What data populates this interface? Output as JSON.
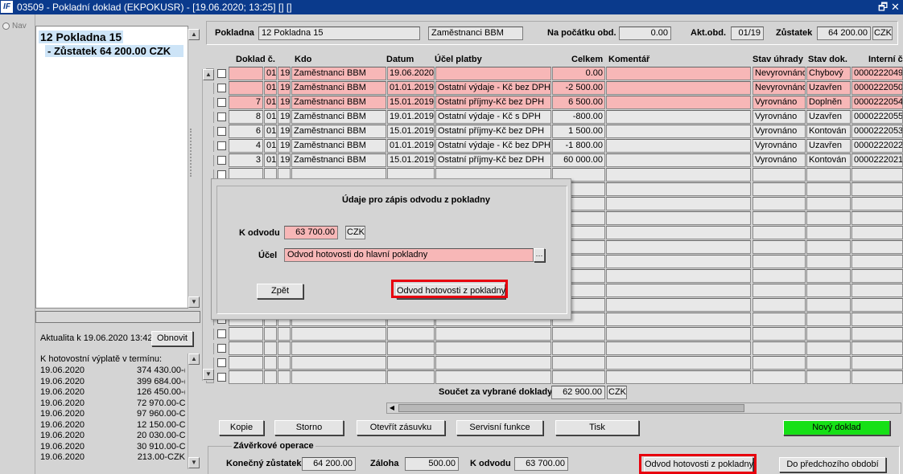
{
  "window": {
    "title": "03509 - Pokladní doklad (EKPOKUSR) - [19.06.2020; 13:25] [] []",
    "logo": "IF",
    "restore_glyph": "🗗",
    "close_glyph": "✕"
  },
  "nav": {
    "label": "Nav"
  },
  "tree": {
    "root": "12 Pokladna 15",
    "child": "- Zůstatek 64 200.00 CZK"
  },
  "aktualita": {
    "label": "Aktualita k 19.06.2020 13:42",
    "refresh_button": "Obnovit"
  },
  "payments": {
    "title": "K hotovostní výplatě v termínu:",
    "rows": [
      {
        "date": "19.06.2020",
        "amount": "374 430.00-("
      },
      {
        "date": "19.06.2020",
        "amount": "399 684.00-("
      },
      {
        "date": "19.06.2020",
        "amount": "126 450.00-("
      },
      {
        "date": "19.06.2020",
        "amount": "72 970.00-C"
      },
      {
        "date": "19.06.2020",
        "amount": "97 960.00-C"
      },
      {
        "date": "19.06.2020",
        "amount": "12 150.00-C"
      },
      {
        "date": "19.06.2020",
        "amount": "20 030.00-C"
      },
      {
        "date": "19.06.2020",
        "amount": "30 910.00-C"
      },
      {
        "date": "19.06.2020",
        "amount": "213.00-CZK"
      }
    ]
  },
  "header": {
    "pokladna_label": "Pokladna",
    "pokladna_value": "12 Pokladna 15",
    "group_value": "Zaměstnanci BBM",
    "nazacatku_label": "Na počátku obd.",
    "nazacatku_value": "0.00",
    "aktobd_label": "Akt.obd.",
    "aktobd_value": "01/19",
    "zustatek_label": "Zůstatek",
    "zustatek_value": "64 200.00",
    "currency": "CZK"
  },
  "table": {
    "columns": [
      "Doklad č.",
      "Kdo",
      "Datum",
      "Účel platby",
      "Celkem",
      "Komentář",
      "Stav úhrady",
      "Stav dok.",
      "Interní č."
    ],
    "rows": [
      {
        "doklad": "",
        "m": "01",
        "y": "19",
        "kdo": "Zaměstnanci BBM",
        "datum": "19.06.2020",
        "ucel": "",
        "celkem": "0.00",
        "komentar": "",
        "stav_uhrady": "Nevyrovnáno",
        "stav_dok": "Chybový",
        "interni": "0000222049"
      },
      {
        "doklad": "",
        "m": "01",
        "y": "19",
        "kdo": "Zaměstnanci BBM",
        "datum": "01.01.2019",
        "ucel": "Ostatní výdaje - Kč bez DPH (",
        "celkem": "-2 500.00",
        "komentar": "",
        "stav_uhrady": "Nevyrovnáno",
        "stav_dok": "Uzavřen",
        "interni": "0000222050"
      },
      {
        "doklad": "7",
        "m": "01",
        "y": "19",
        "kdo": "Zaměstnanci BBM",
        "datum": "15.01.2019",
        "ucel": "Ostatní příjmy-Kč bez DPH",
        "celkem": "6 500.00",
        "komentar": "",
        "stav_uhrady": "Vyrovnáno",
        "stav_dok": "Doplněn",
        "interni": "0000222054"
      },
      {
        "doklad": "8",
        "m": "01",
        "y": "19",
        "kdo": "Zaměstnanci BBM",
        "datum": "19.01.2019",
        "ucel": "Ostatní výdaje - Kč s DPH",
        "celkem": "-800.00",
        "komentar": "",
        "stav_uhrady": "Vyrovnáno",
        "stav_dok": "Uzavřen",
        "interni": "0000222055"
      },
      {
        "doklad": "6",
        "m": "01",
        "y": "19",
        "kdo": "Zaměstnanci BBM",
        "datum": "15.01.2019",
        "ucel": "Ostatní příjmy-Kč bez DPH",
        "celkem": "1 500.00",
        "komentar": "",
        "stav_uhrady": "Vyrovnáno",
        "stav_dok": "Kontován",
        "interni": "0000222053"
      },
      {
        "doklad": "4",
        "m": "01",
        "y": "19",
        "kdo": "Zaměstnanci BBM",
        "datum": "01.01.2019",
        "ucel": "Ostatní výdaje - Kč bez DPH (",
        "celkem": "-1 800.00",
        "komentar": "",
        "stav_uhrady": "Vyrovnáno",
        "stav_dok": "Uzavřen",
        "interni": "0000222022"
      },
      {
        "doklad": "3",
        "m": "01",
        "y": "19",
        "kdo": "Zaměstnanci BBM",
        "datum": "15.01.2019",
        "ucel": "Ostatní příjmy-Kč bez DPH",
        "celkem": "60 000.00",
        "komentar": "",
        "stav_uhrady": "Vyrovnáno",
        "stav_dok": "Kontován",
        "interni": "0000222021"
      }
    ]
  },
  "dialog": {
    "title": "Údaje pro zápis odvodu z pokladny",
    "k_odvodu_label": "K odvodu",
    "k_odvodu_value": "63 700.00",
    "currency": "CZK",
    "ucel_label": "Účel",
    "ucel_value": "Odvod hotovosti do hlavní pokladny",
    "lookup_glyph": "···",
    "back_button": "Zpět",
    "submit_button": "Odvod hotovosti z pokladny"
  },
  "summary": {
    "label": "Součet za vybrané doklady",
    "value": "62 900.00",
    "currency": "CZK"
  },
  "buttons": {
    "kopie": "Kopie",
    "storno": "Storno",
    "otevrit": "Otevřít zásuvku",
    "servisni": "Servisní funkce",
    "tisk": "Tisk",
    "novy": "Nový doklad"
  },
  "zaverkove": {
    "title": "Závěrkové operace",
    "konecny_label": "Konečný zůstatek",
    "konecny_value": "64 200.00",
    "zaloha_label": "Záloha",
    "zaloha_value": "500.00",
    "k_odvodu_label": "K odvodu",
    "k_odvodu_value": "63 700.00",
    "odvod_button": "Odvod hotovosti z pokladny",
    "predchozi_button": "Do předchozího období"
  },
  "colors": {
    "title_bar": "#0a3a8c",
    "highlight_row": "#f7b7b7",
    "new_button": "#16e016",
    "callout": "#e8000e"
  }
}
